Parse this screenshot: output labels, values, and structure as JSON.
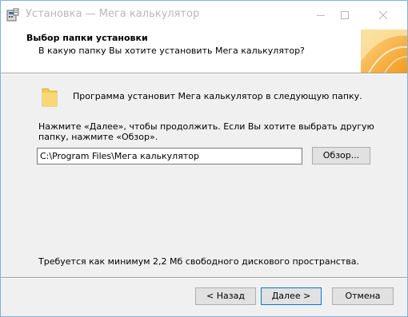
{
  "window": {
    "title": "Установка — Мега калькулятор"
  },
  "header": {
    "title": "Выбор папки установки",
    "subtitle": "В какую папку Вы хотите установить Мега калькулятор?"
  },
  "body": {
    "info": "Программа установит Мега калькулятор в следующую папку.",
    "instruction": "Нажмите «Далее», чтобы продолжить. Если Вы хотите выбрать другую папку, нажмите «Обзор».",
    "path_value": "C:\\Program Files\\Мега калькулятор",
    "browse_label": "Обзор...",
    "space_required": "Требуется как минимум 2,2 Мб свободного дискового пространства."
  },
  "footer": {
    "back_label": "< Назад",
    "next_label": "Далее >",
    "cancel_label": "Отмена"
  },
  "icons": {
    "app": "installer-icon",
    "folder": "folder-icon",
    "minimize": "minimize-icon",
    "maximize": "maximize-icon",
    "close": "close-icon"
  },
  "colors": {
    "accent": "#0078d7",
    "folder": "#f5c953",
    "header_art": "#f4a623"
  }
}
